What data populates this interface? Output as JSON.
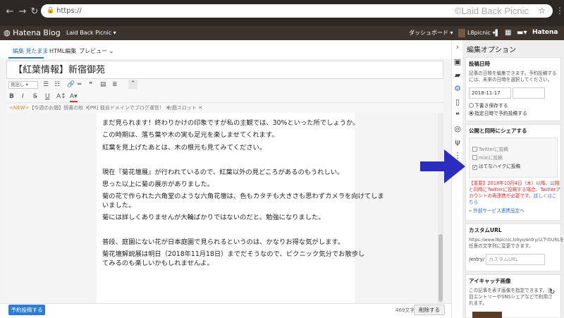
{
  "browser": {
    "url": "https://",
    "watermark": "©Laid Back Picnic",
    "star_icon": "star-icon",
    "back_icon": "back-arrow-icon",
    "forward_icon": "forward-arrow-icon",
    "refresh_icon": "refresh-icon"
  },
  "hatena_bar": {
    "logo": "Hatena Blog",
    "blog_name": "Laid Back Picnic ▾",
    "dashboard": "ダッシュボード ▾",
    "user": "L8picnic ▾",
    "brand": "Hatena"
  },
  "editor": {
    "tabs": [
      {
        "label": "編集 見たまま",
        "active": true
      },
      {
        "label": "HTML編集",
        "active": false
      },
      {
        "label": "プレビュー ⌄",
        "active": false
      }
    ],
    "title": "【紅葉情報】新宿御苑",
    "format_select": "見出し",
    "topics": [
      {
        "prefix": "<NEW>",
        "label": "【今週のお題】読書の秋 ✕"
      },
      {
        "prefix": "",
        "label": "[PR] 独自ドメインでブログ運営！ ✕"
      },
      {
        "prefix": "",
        "label": "お題スロット ✕"
      }
    ],
    "body_lines": [
      "まだ見られます！終わりかけの印象ですが私の主観では、30%といった所でしょうか。",
      "この時期は、落ち葉や木の実も足元を楽しませてくれます。",
      "紅葉を見上げたあとは、木の根元も見てみてください。",
      "",
      "現在『菊花壇展』が行われているので、紅葉以外の見どころがあるのもうれしい。",
      "思った以上に菊の展示がありました。",
      "菊の花で作られた六角堂のような六角花壇は、色もカタチも大きさも思わずカメラを向けてしま",
      "いました。",
      "菊には詳しくありませんが大輪ばかりではないのだと、勉強になりました。",
      "",
      "",
      "普段、庭園にない花が日本庭園で見られるというのは、かなりお得な気がします。",
      "菊花壇解説展は明日（2018年11月18日）までだそうなので、ピクニック気分でお散歩し",
      "てみるのも楽しいかもしれませんよ。"
    ],
    "schedule_button": "予約投稿する",
    "char_count": "469文字",
    "delete_button": "削除する"
  },
  "sidebar": {
    "title": "編集オプション",
    "post_date": {
      "heading": "投稿日時",
      "desc": "記事の日時を編集できます。予約投稿するには、未来の日時を選択してください。",
      "date_value": "2018-11-17",
      "time_value": "",
      "option_draft": "下書き保存する",
      "option_schedule": "指定日時で予約投稿する"
    },
    "share": {
      "heading": "公開と同時にシェアする",
      "twitter": "Twitterに投稿",
      "mixi": "mixiに投稿",
      "haiku": "はてなハイクに投稿",
      "notice_1": "【重要】2018年10月4日（木）以降、公開",
      "notice_2": "と同時にTwitterに投稿する場合、Twitterア",
      "notice_3": "カウントの再連携が必要です。",
      "notice_link": "詳しくはこ",
      "notice_link2": "ちら",
      "external_link": "» 外部サービス連携設定へ"
    },
    "custom_url": {
      "heading": "カスタムURL",
      "desc_1": "https://www.l8picnic.tokyo/entry/以下のURLを",
      "desc_2": "任意の文字列に変更できます。",
      "prefix": "/entry/",
      "placeholder": "カスタムURL"
    },
    "eyecatch": {
      "heading": "アイキャッチ画像",
      "desc_1": "この記事を表す画像を指定できます。注",
      "desc_2": "目エントリーやSNSシェアなどで利用さ",
      "desc_3": "れます。"
    }
  },
  "colors": {
    "accent": "#3571b8",
    "hatena_bar": "#3b332c",
    "browser_chrome": "#2b2826",
    "arrow": "#2a2dbf",
    "notice": "#dd3333"
  }
}
